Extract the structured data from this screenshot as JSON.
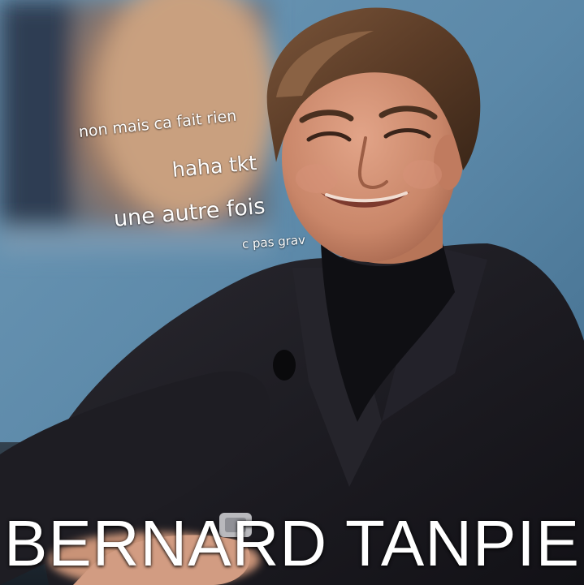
{
  "meme": {
    "captions": [
      "non mais ca fait rien",
      "haha tkt",
      "une autre fois",
      "c pas grav"
    ],
    "title": "BERNARD TANPIE"
  },
  "colors": {
    "backdrop": "#5b88a8",
    "suit": "#1d1c22",
    "skin": "#cf8e74",
    "hair": "#5a3b26",
    "caption_text": "#ffffff"
  }
}
